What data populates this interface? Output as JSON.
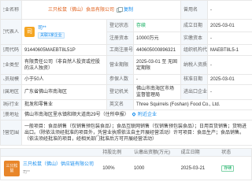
{
  "info": {
    "name": {
      "label": "企业名称",
      "value": "三只松鼠（佛山）食品有限公司",
      "copy": "复制"
    },
    "alias": {
      "label": "曾用名",
      "value": "-"
    },
    "legal_rep": {
      "label": "法定代表人",
      "avatar": "司",
      "name": "司**",
      "tag": "关联1家企业"
    },
    "status": {
      "label": "登记状态",
      "value": "存续"
    },
    "founded": {
      "label": "成立日期",
      "value": "2025-03-01"
    },
    "capital": {
      "label": "注册资本",
      "value": "10000万元"
    },
    "paid_capital": {
      "label": "实缴资本",
      "value": "-"
    },
    "credit_code": {
      "label": "统一社会信用代码",
      "value": "91440605MAEBT8L51P"
    },
    "reg_no": {
      "label": "工商注册号",
      "value": "440605000896321"
    },
    "org_code": {
      "label": "组织机构代码",
      "value": "MAEBT8L5-1"
    },
    "company_type": {
      "label": "企业类型",
      "value": "有限责任公司（非自然人投资或控股的法人独资）"
    },
    "term": {
      "label": "营业期限",
      "value": "2025-03-01 至 无固定期限"
    },
    "taxpayer": {
      "label": "纳税人资质",
      "value": "-"
    },
    "staff": {
      "label": "人员规模",
      "value": "小于50人"
    },
    "insured": {
      "label": "参保人数",
      "value": "-"
    },
    "approved": {
      "label": "核准日期",
      "value": "2025-03-01"
    },
    "region": {
      "label": "所属地区",
      "value": "广东省佛山市南海区"
    },
    "authority": {
      "label": "登记机关",
      "value": "佛山市南海区市场监督管理局"
    },
    "import_code": {
      "label": "进出口企业代码",
      "value": "-"
    },
    "industry": {
      "label": "国标行业",
      "value": "批发和零售业"
    },
    "english": {
      "label": "英文名",
      "value": "Three Squirrels (Foshan) Food Co., Ltd."
    },
    "address": {
      "label": "注册地址",
      "value": "佛山市南海区里水镇和顺大道南29号（住所申报）",
      "nearby": "附近企业"
    },
    "scope": {
      "label": "经营范围",
      "value": "一般项目：食品销售（仅销售预包装食品）；食品互联网销售（仅销售预包装食品）；日用百货销售；货物进出口。（除依法须经批准的项目外，凭营业执照依法自主开展经营活动）许可项目：食品生产；食品销售。（依法须经批准的项目，经相关部门批准后方可开展经营活动）"
    }
  },
  "investment": {
    "headers": {
      "ratio": "持股比例",
      "amount": "认缴出资额(万元)",
      "date": "成立日期",
      "status": "状态"
    },
    "rows": [
      {
        "logo": "三只松鼠",
        "name": "三只松鼠（佛山）供应链有限公司",
        "sub": "司**",
        "ratio": "100%",
        "amount": "1000",
        "date": "2025-03-21",
        "status": "存续"
      }
    ]
  },
  "colors": {
    "link": "#128bed",
    "company_name": "#e0601c",
    "label_bg": "#f3f7fb",
    "border": "#e8e8e8",
    "status_green": "#00a854",
    "logo": "#e8862a"
  },
  "icons": [
    "copy-icon",
    "location-pin-icon"
  ]
}
